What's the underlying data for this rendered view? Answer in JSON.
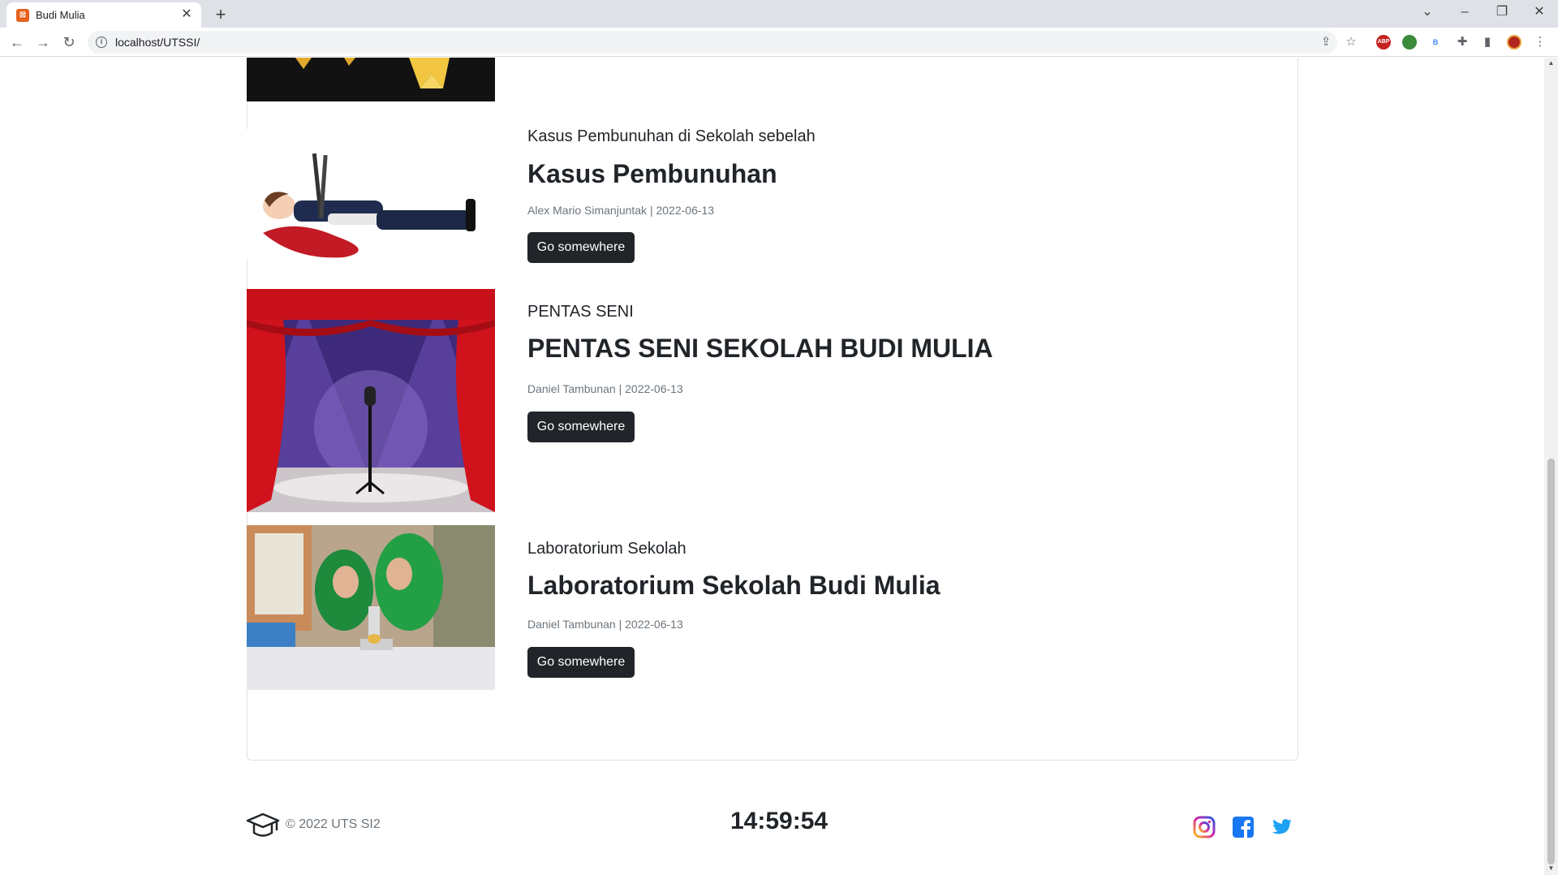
{
  "browser": {
    "tab_title": "Budi Mulia",
    "tab_close": "✕",
    "new_tab": "+",
    "url": "localhost/UTSSI/",
    "window_controls": {
      "dropdown": "⌄",
      "minimize": "–",
      "restore": "❐",
      "close": "✕"
    },
    "extensions": [
      "ABP",
      "",
      "B"
    ]
  },
  "posts": [
    {
      "subtitle": "Kasus Pembunuhan di Sekolah sebelah",
      "title": "Kasus Pembunuhan",
      "meta": "Alex Mario Simanjuntak | 2022-06-13",
      "button": "Go somewhere",
      "image_icon": "crime-scene-illustration"
    },
    {
      "subtitle": "PENTAS SENI",
      "title": "PENTAS SENI SEKOLAH BUDI MULIA",
      "meta": "Daniel Tambunan | 2022-06-13",
      "button": "Go somewhere",
      "image_icon": "stage-curtain-microphone-illustration"
    },
    {
      "subtitle": "Laboratorium Sekolah",
      "title": "Laboratorium Sekolah Budi Mulia",
      "meta": "Daniel Tambunan | 2022-06-13",
      "button": "Go somewhere",
      "image_icon": "students-with-microscope-photo"
    }
  ],
  "footer": {
    "copyright": "© 2022 UTS SI2",
    "clock": "14:59:54",
    "social": [
      "instagram-icon",
      "facebook-icon",
      "twitter-icon"
    ]
  },
  "colors": {
    "button_bg": "#212529",
    "instagram": "#d6249f",
    "facebook": "#1877f2",
    "twitter": "#1da1f2"
  }
}
